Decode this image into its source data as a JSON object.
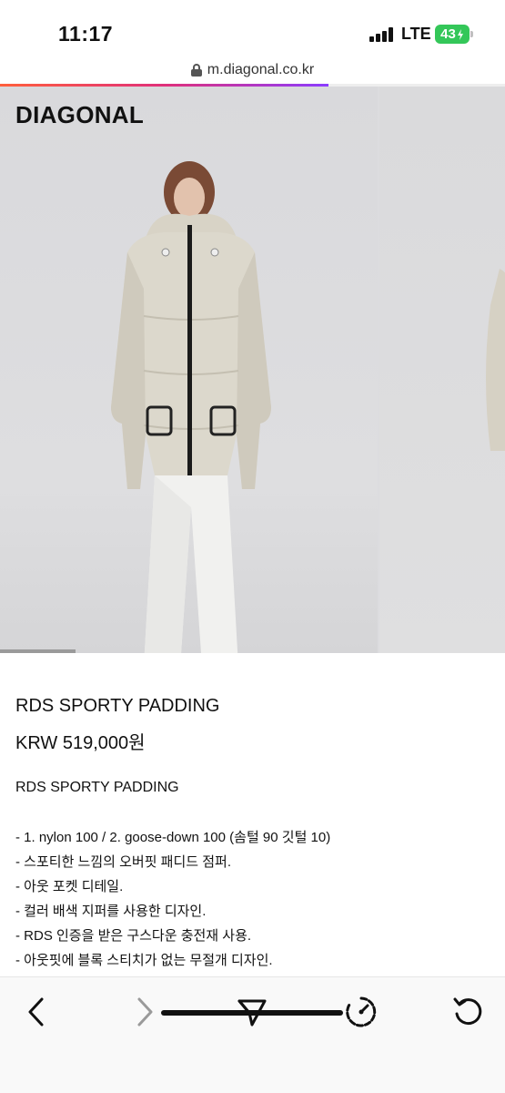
{
  "status_bar": {
    "time": "11:17",
    "network": "LTE",
    "battery": "43"
  },
  "browser": {
    "url": "m.diagonal.co.kr",
    "load_progress": 0.65
  },
  "hero": {
    "brand": "DIAGONAL",
    "slide_indicator_fraction": 0.2
  },
  "product": {
    "name": "RDS SPORTY PADDING",
    "price": "KRW 519,000원",
    "description_title": "RDS SPORTY PADDING",
    "description_items": [
      "- 1. nylon 100 / 2. goose-down 100 (솜털 90 깃털 10)",
      "- 스포티한 느낌의 오버핏 패디드 점퍼.",
      "- 아웃 포켓 디테일.",
      "- 컬러 배색 지퍼를 사용한 디자인.",
      "- RDS 인증을 받은 구스다운 충전재 사용.",
      "- 아웃핏에 블록 스티치가 없는 무절개 디자인."
    ]
  },
  "toolbar": {
    "icons": [
      "back-icon",
      "forward-icon",
      "share-icon",
      "speed-icon",
      "reload-icon"
    ]
  },
  "colors": {
    "battery": "#34c759",
    "jacket": "#dcd8cc",
    "background": "#ffffff"
  }
}
